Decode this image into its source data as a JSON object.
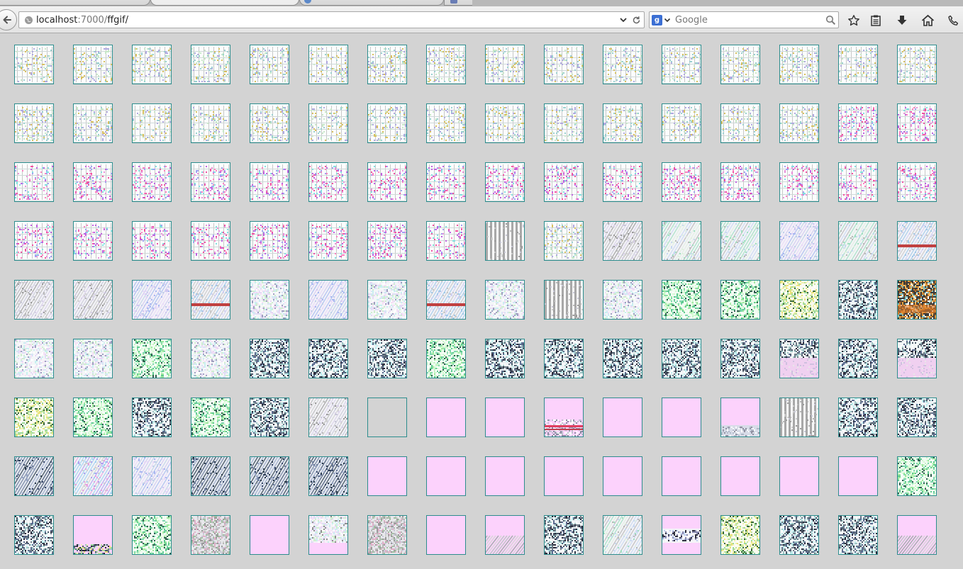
{
  "browser": {
    "url": {
      "host": "localhost",
      "port_part": ":7000/",
      "path": "ffgif/"
    },
    "search": {
      "engine_badge": "g",
      "placeholder": "Google"
    },
    "icons": {
      "back": "back-arrow-icon",
      "site": "globe-icon",
      "url_dropdown": "chevron-down-icon",
      "reload": "reload-icon",
      "search_engine": "google-icon",
      "search_go": "magnifier-icon",
      "bookmark": "star-icon",
      "reading_list": "clipboard-icon",
      "downloads": "download-arrow-icon",
      "home": "home-icon",
      "phone": "phone-icon"
    }
  },
  "palette": {
    "page_bg": "#d3d3d3",
    "thumb_border": "#2d8d8d",
    "pink_fill": "#fcd2fc"
  },
  "grid": {
    "rows": 9,
    "cols": 16,
    "styles": [
      "frame-white",
      "frame-white",
      "frame-white",
      "frame-white",
      "frame-white",
      "frame-white",
      "frame-white",
      "frame-white",
      "frame-white",
      "frame-white",
      "frame-white",
      "frame-white",
      "frame-white",
      "frame-white",
      "frame-white",
      "frame-white",
      "frame-white",
      "frame-white",
      "frame-white",
      "frame-white",
      "frame-white",
      "frame-white",
      "frame-white",
      "frame-white",
      "frame-white",
      "frame-white",
      "frame-white",
      "frame-white",
      "frame-white",
      "frame-white",
      "frame-pink",
      "frame-pink",
      "frame-pink",
      "frame-pink",
      "frame-pink",
      "frame-pink",
      "frame-pink",
      "frame-pink",
      "frame-pink",
      "frame-pink",
      "frame-pink",
      "frame-pink",
      "frame-pink",
      "frame-pink",
      "frame-pink",
      "frame-pink",
      "frame-pink",
      "frame-pink",
      "frame-pink",
      "frame-pink",
      "frame-pink",
      "frame-pink",
      "frame-pink",
      "frame-pink",
      "frame-pink",
      "frame-pink",
      "stripes-gray",
      "frame-white",
      "diag-gray",
      "diag-green",
      "diag-green",
      "diag-blue",
      "diag-green",
      "diag-red",
      "diag-gray",
      "diag-gray",
      "diag-blue",
      "diag-red",
      "noise-light",
      "diag-blue",
      "noise-light",
      "diag-red",
      "noise-light",
      "stripes-gray",
      "noise-light",
      "noise-green",
      "noise-green",
      "noise-yellow",
      "noise-dark",
      "noise-orange",
      "noise-light",
      "noise-light",
      "noise-green",
      "noise-light",
      "noise-dark",
      "noise-dark",
      "noise-dark",
      "noise-green",
      "noise-dark",
      "noise-dark",
      "noise-dark",
      "noise-dark",
      "noise-dark",
      "noise-pinkband",
      "noise-dark",
      "noise-pinkband",
      "noise-yellow",
      "noise-green",
      "noise-dark",
      "noise-green",
      "noise-dark",
      "diag-gray",
      "empty-gray",
      "pink",
      "pink",
      "pink-redband",
      "pink",
      "pink",
      "pink-bottom",
      "stripes-gray",
      "noise-dark",
      "noise-dark",
      "diag-dark",
      "diag-pink",
      "diag-blue",
      "diag-dark",
      "diag-dark",
      "diag-dark",
      "pink",
      "pink",
      "pink",
      "pink",
      "pink",
      "pink",
      "pink",
      "pink",
      "pink",
      "noise-green",
      "noise-dark",
      "pink-noisebottom",
      "noise-green",
      "noise-gray",
      "pink",
      "noise-pinkbottom",
      "noise-gray",
      "pink",
      "pink-diagbottom",
      "noise-dark",
      "diag-green",
      "pink-band",
      "noise-yellow",
      "noise-dark",
      "noise-dark",
      "pink-diagbottom"
    ]
  }
}
